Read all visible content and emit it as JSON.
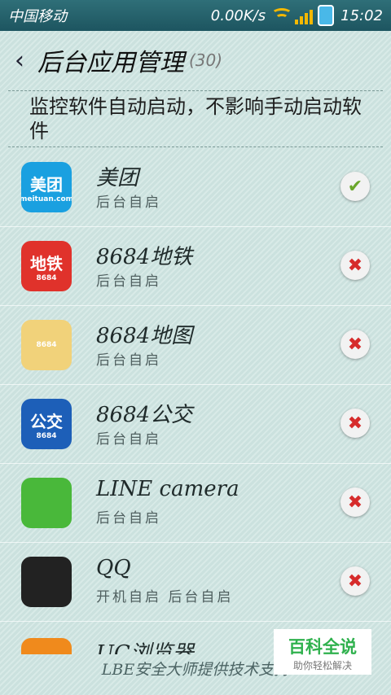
{
  "status_bar": {
    "carrier": "中国移动",
    "speed": "0.00K/s",
    "time": "15:02"
  },
  "title_bar": {
    "title": "后台应用管理",
    "count": "(30)"
  },
  "description": "监控软件自动启动，不影响手动启动软件",
  "apps": [
    {
      "name": "美团",
      "status": "后台自启",
      "enabled": true,
      "icon": "meituan-icon",
      "icon_text": "美团",
      "icon_sub": "meituan.com",
      "color": "#1aa0e0"
    },
    {
      "name": "8684地铁",
      "status": "后台自启",
      "enabled": false,
      "icon": "8684-subway-icon",
      "icon_text": "地铁",
      "icon_sub": "8684",
      "color": "#e0322b"
    },
    {
      "name": "8684地图",
      "status": "后台自启",
      "enabled": false,
      "icon": "8684-map-icon",
      "icon_text": "",
      "icon_sub": "8684",
      "color": "#f1d27a"
    },
    {
      "name": "8684公交",
      "status": "后台自启",
      "enabled": false,
      "icon": "8684-bus-icon",
      "icon_text": "公交",
      "icon_sub": "8684",
      "color": "#1d5fb8"
    },
    {
      "name": "LINE camera",
      "status": "后台自启",
      "enabled": false,
      "icon": "line-camera-icon",
      "icon_text": "",
      "icon_sub": "",
      "color": "#49b83a"
    },
    {
      "name": "QQ",
      "status": "开机自启 后台自启",
      "enabled": false,
      "icon": "qq-icon",
      "icon_text": "",
      "icon_sub": "",
      "color": "#222222"
    }
  ],
  "partial_next": {
    "name": "UC浏览器"
  },
  "footer": "LBE安全大师提供技术支持",
  "watermark": {
    "title": "百科全说",
    "subtitle": "助你轻松解决"
  }
}
